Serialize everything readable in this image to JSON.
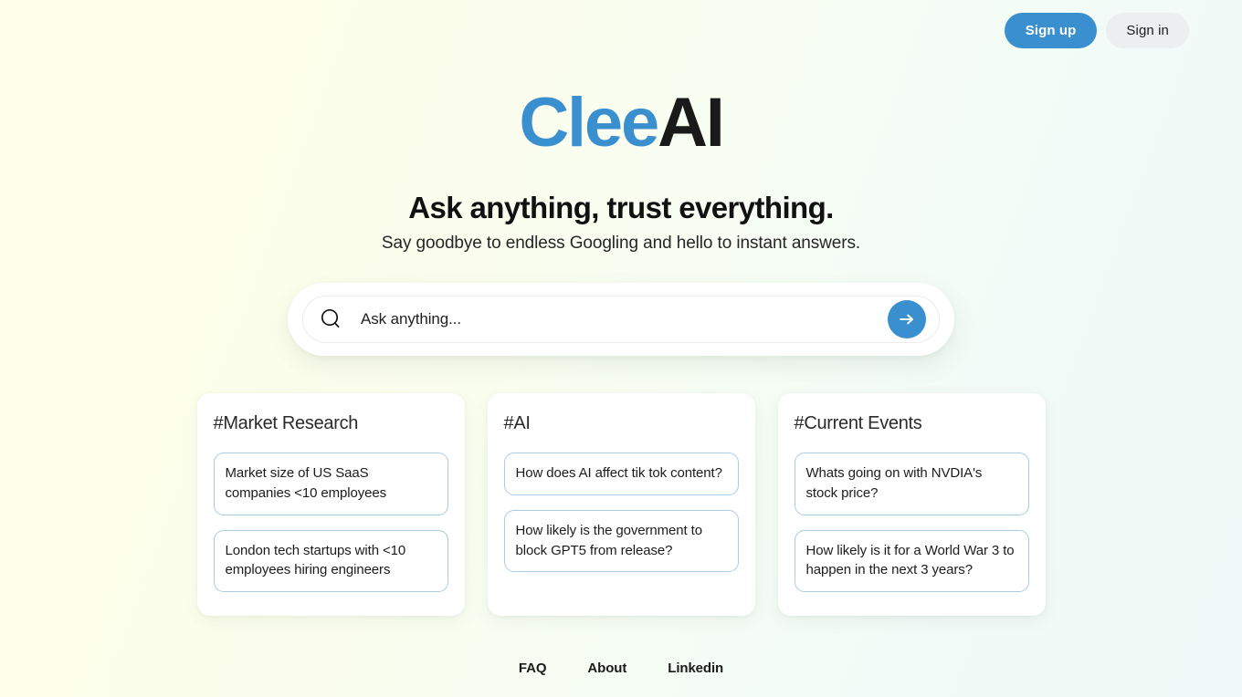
{
  "topbar": {
    "sign_up_label": "Sign up",
    "sign_in_label": "Sign in"
  },
  "brand": {
    "name_part1": "Clee",
    "name_part2": "AI",
    "color_primary": "#3a90cf",
    "color_secondary": "#1a1a1a"
  },
  "hero": {
    "headline": "Ask anything, trust everything.",
    "subhead": "Say goodbye to endless Googling and hello to instant answers."
  },
  "search": {
    "placeholder": "Ask anything...",
    "value": "",
    "icon": "search-icon",
    "submit_icon": "arrow-right-icon"
  },
  "cards": [
    {
      "title": "#Market Research",
      "suggestions": [
        "Market size of US SaaS companies <10 employees",
        "London tech startups with <10 employees hiring engineers"
      ]
    },
    {
      "title": "#AI",
      "suggestions": [
        "How does AI affect tik tok content?",
        "How likely is the government to block GPT5 from release?"
      ]
    },
    {
      "title": "#Current Events",
      "suggestions": [
        "Whats going on with NVDIA's stock price?",
        "How likely is it for a World War 3 to happen in the next 3 years?"
      ]
    }
  ],
  "footer": {
    "links": [
      {
        "label": "FAQ"
      },
      {
        "label": "About"
      },
      {
        "label": "Linkedin"
      }
    ]
  }
}
